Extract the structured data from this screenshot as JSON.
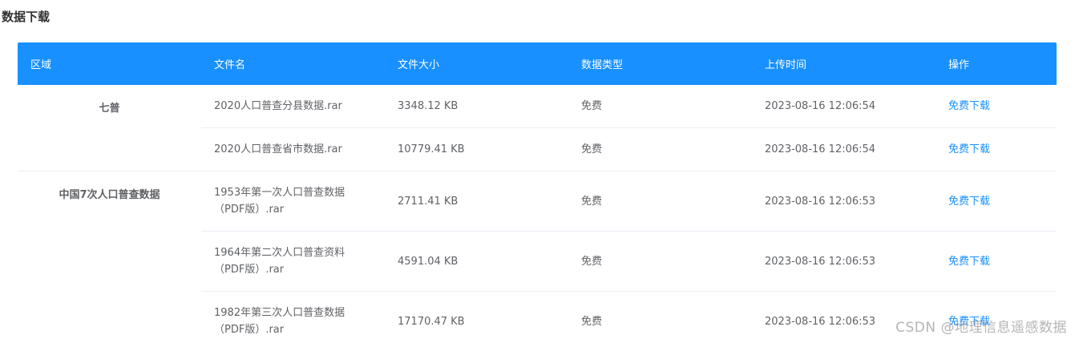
{
  "page": {
    "title": "数据下载"
  },
  "table": {
    "headers": [
      "区域",
      "文件名",
      "文件大小",
      "数据类型",
      "上传时间",
      "操作"
    ],
    "groups": [
      {
        "region": "七普",
        "rows": [
          {
            "name": "2020人口普查分县数据.rar",
            "size": "3348.12 KB",
            "type": "免费",
            "time": "2023-08-16 12:06:54",
            "action": "免费下载"
          },
          {
            "name": "2020人口普查省市数据.rar",
            "size": "10779.41 KB",
            "type": "免费",
            "time": "2023-08-16 12:06:54",
            "action": "免费下载"
          }
        ]
      },
      {
        "region": "中国7次人口普查数据",
        "rows": [
          {
            "name": "1953年第一次人口普查数据（PDF版）.rar",
            "size": "2711.41 KB",
            "type": "免费",
            "time": "2023-08-16 12:06:53",
            "action": "免费下载"
          },
          {
            "name": "1964年第二次人口普查资料（PDF版）.rar",
            "size": "4591.04 KB",
            "type": "免费",
            "time": "2023-08-16 12:06:53",
            "action": "免费下载"
          },
          {
            "name": "1982年第三次人口普查数据（PDF版）.rar",
            "size": "17170.47 KB",
            "type": "免费",
            "time": "2023-08-16 12:06:53",
            "action": "免费下载"
          }
        ]
      }
    ]
  },
  "watermark": "CSDN @地理信息遥感数据",
  "colors": {
    "header_bg": "#1890ff",
    "link": "#1890ff",
    "border": "#ebeef5"
  }
}
